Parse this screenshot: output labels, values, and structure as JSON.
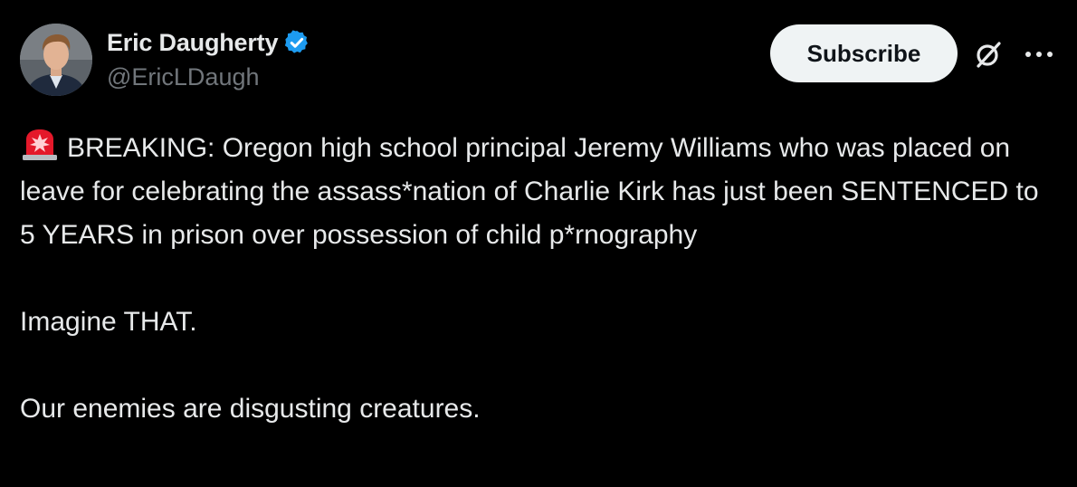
{
  "author": {
    "display_name": "Eric Daugherty",
    "handle": "@EricLDaugh",
    "verified": true,
    "verified_color": "#1d9bf0",
    "avatar": "avatar-photo"
  },
  "actions": {
    "subscribe_label": "Subscribe",
    "grok_icon": "slashed-circle-icon",
    "more_icon": "more-horizontal-icon"
  },
  "post": {
    "emoji": "police-siren-icon",
    "paragraphs": [
      "BREAKING: Oregon high school principal Jeremy Williams who was placed on leave for celebrating the assass*nation of Charlie Kirk has just been SENTENCED to 5 YEARS in prison over possession of child p*rnography",
      "Imagine THAT.",
      "Our enemies are disgusting creatures."
    ]
  },
  "colors": {
    "background": "#000000",
    "text": "#e7e9ea",
    "secondary_text": "#71767b",
    "button_bg": "#eff3f4",
    "button_text": "#0f1419"
  }
}
